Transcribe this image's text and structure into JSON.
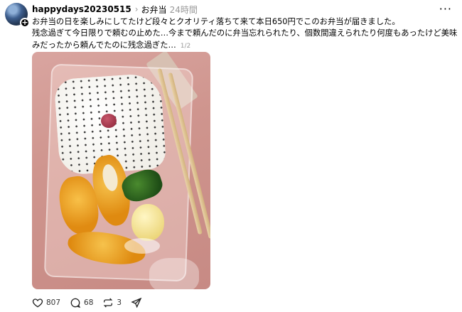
{
  "post": {
    "username": "happydays20230515",
    "chevron": "›",
    "topic": "お弁当",
    "timestamp": "24時間",
    "more": "···",
    "lines": [
      "お弁当の日を楽しみにしてたけど段々とクオリティ落ちて来て本日650円でこのお弁当が届きました。",
      "残念過ぎて今日限りで頼むの止めた…今まで頼んだのに弁当忘れられたり、個数間違えられたり何度もあったけど美味しいし楽し",
      "みだったから頼んでたのに残念過ぎた…"
    ],
    "media_counter": "1/2"
  },
  "avatar": {
    "badge": "+"
  },
  "actions": {
    "likes": "807",
    "replies": "68",
    "reposts": "3"
  },
  "icons": {
    "like": "heart-icon",
    "reply": "comment-icon",
    "repost": "repost-icon",
    "share": "send-icon"
  }
}
